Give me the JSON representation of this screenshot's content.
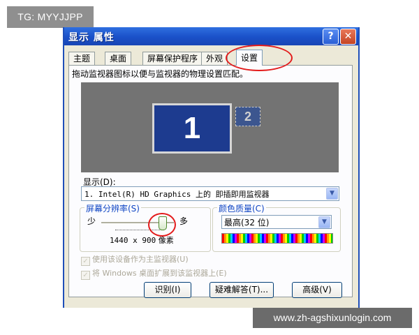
{
  "overlay_tag": "TG: MYYJJPP",
  "watermark": "www.zh-agshixunlogin.com",
  "window": {
    "title": "显示 属性",
    "help_button": "?",
    "close_button": "✕"
  },
  "tabs": [
    {
      "label": "主题"
    },
    {
      "label": "桌面"
    },
    {
      "label": "屏幕保护程序"
    },
    {
      "label": "外观"
    },
    {
      "label": "设置",
      "active": true
    }
  ],
  "instructions": "拖动监视器图标以便与监视器的物理设置匹配。",
  "monitors": {
    "primary": "1",
    "secondary": "2"
  },
  "display": {
    "label": "显示(D):",
    "selected": "1. Intel(R) HD Graphics 上的 即插即用监视器"
  },
  "resolution": {
    "group_label": "屏幕分辨率(S)",
    "less_label": "少",
    "more_label": "多",
    "value_numbers": "1440 x 900",
    "value_unit": "像素",
    "slider_level": 0.85
  },
  "color_quality": {
    "group_label": "颜色质量(C)",
    "selected": "最高(32 位)"
  },
  "checkboxes": [
    {
      "label": "使用该设备作为主监视器(U)",
      "checked": true,
      "disabled": true
    },
    {
      "label": "将 Windows 桌面扩展到该监视器上(E)",
      "checked": true,
      "disabled": true
    }
  ],
  "buttons": {
    "identify": "识别(I)",
    "troubleshoot": "疑难解答(T)...",
    "advanced": "高级(V)"
  },
  "colors": {
    "title_bar": "#1a50c8",
    "annotation_red": "#e31b1b",
    "group_title": "#1046c4",
    "monitor_primary": "#1d3b8f",
    "preview_bg": "#737373"
  },
  "icons": {
    "dropdown": "chevron-down-icon",
    "checkbox": "check-icon"
  }
}
